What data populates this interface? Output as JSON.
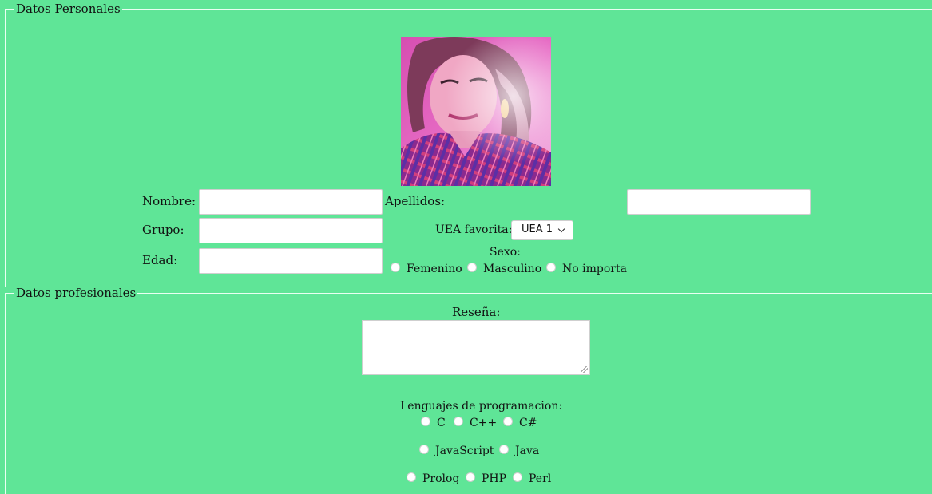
{
  "personal": {
    "legend": "Datos Personales",
    "labels": {
      "nombre": "Nombre:",
      "apellidos": "Apellidos:",
      "grupo": "Grupo:",
      "edad": "Edad:",
      "uea_favorita": "UEA favorita:",
      "sexo": "Sexo:"
    },
    "fields": {
      "nombre": "",
      "apellidos": "",
      "grupo": "",
      "edad": ""
    },
    "uea_selected": "UEA 1",
    "sexo_options": [
      "Femenino",
      "Masculino",
      "No importa"
    ]
  },
  "professional": {
    "legend": "Datos profesionales",
    "resena_label": "Reseña:",
    "resena_value": "",
    "lenguajes_label": "Lenguajes de programacion:",
    "lenguajes_rows": [
      [
        "C",
        "C++",
        "C#"
      ],
      [
        "JavaScript",
        "Java"
      ],
      [
        "Prolog",
        "PHP",
        "Perl"
      ]
    ]
  },
  "colors": {
    "background": "#5fe597",
    "photo_dominant": "#c94fa8"
  }
}
